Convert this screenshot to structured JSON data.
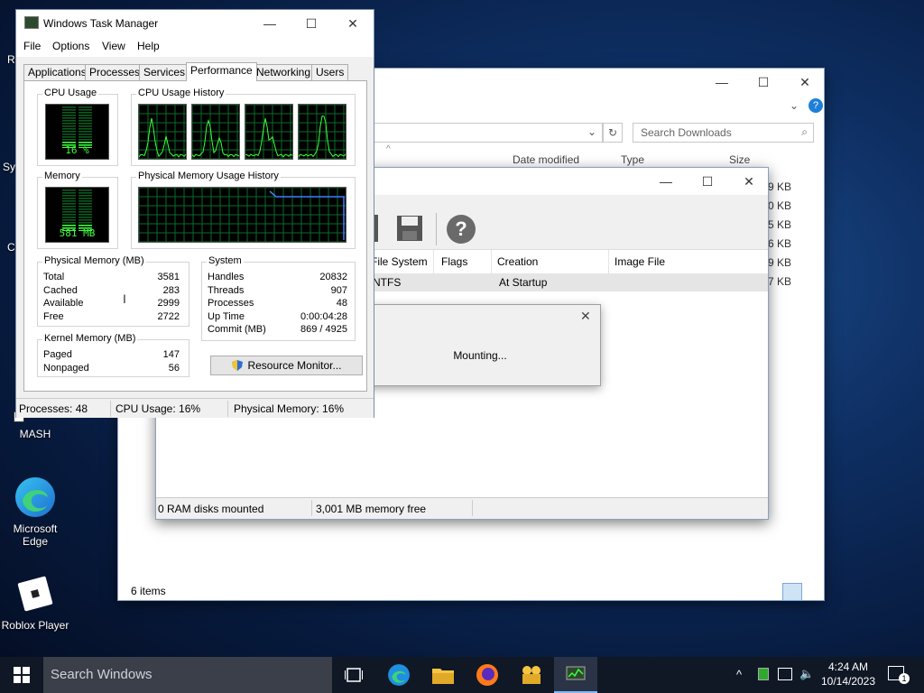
{
  "desktop": {
    "partial_labels": [
      "R",
      "Sys",
      "C"
    ],
    "icons": [
      {
        "label": "MASH"
      },
      {
        "label_line1": "Microsoft",
        "label_line2": "Edge"
      },
      {
        "label": "Roblox Player"
      }
    ]
  },
  "explorer": {
    "search_placeholder": "Search Downloads",
    "columns": [
      "Date modified",
      "Type",
      "Size"
    ],
    "sizes": [
      "9 KB",
      "0 KB",
      "5 KB",
      "6 KB",
      "9 KB",
      "7 KB"
    ],
    "status_items": "6 items"
  },
  "ramdisk": {
    "columns": [
      "File System",
      "Flags",
      "Creation",
      "Image File"
    ],
    "row": {
      "fs": "NTFS",
      "creation": "At Startup"
    },
    "status_left": "0 RAM disks mounted",
    "status_right": "3,001 MB memory free",
    "help_glyph": "?"
  },
  "mounting": {
    "text": "Mounting..."
  },
  "taskmgr": {
    "title": "Windows Task Manager",
    "menu": [
      "File",
      "Options",
      "View",
      "Help"
    ],
    "tabs": [
      "Applications",
      "Processes",
      "Services",
      "Performance",
      "Networking",
      "Users"
    ],
    "active_tab": "Performance",
    "cpu_usage_label": "CPU Usage",
    "cpu_usage_value": "16 %",
    "cpu_history_label": "CPU Usage History",
    "memory_label": "Memory",
    "memory_value": "581 MB",
    "phys_history_label": "Physical Memory Usage History",
    "physical_memory": {
      "label": "Physical Memory (MB)",
      "rows": [
        [
          "Total",
          "3581"
        ],
        [
          "Cached",
          "283"
        ],
        [
          "Available",
          "2999"
        ],
        [
          "Free",
          "2722"
        ]
      ]
    },
    "kernel_memory": {
      "label": "Kernel Memory (MB)",
      "rows": [
        [
          "Paged",
          "147"
        ],
        [
          "Nonpaged",
          "56"
        ]
      ]
    },
    "system": {
      "label": "System",
      "rows": [
        [
          "Handles",
          "20832"
        ],
        [
          "Threads",
          "907"
        ],
        [
          "Processes",
          "48"
        ],
        [
          "Up Time",
          "0:00:04:28"
        ],
        [
          "Commit (MB)",
          "869 / 4925"
        ]
      ]
    },
    "resource_monitor_label": "Resource Monitor...",
    "status": {
      "processes": "Processes: 48",
      "cpu": "CPU Usage: 16%",
      "memory": "Physical Memory: 16%"
    },
    "cpu_level": 0.16,
    "mem_level": 0.16
  },
  "taskbar": {
    "search_placeholder": "Search Windows",
    "time": "4:24 AM",
    "date": "10/14/2023",
    "notification_count": "1"
  },
  "colors": {
    "graph_green": "#3cff3c",
    "grid": "#0a6b2a",
    "mem_line": "#3c7fff",
    "taskbar": "#101826"
  }
}
